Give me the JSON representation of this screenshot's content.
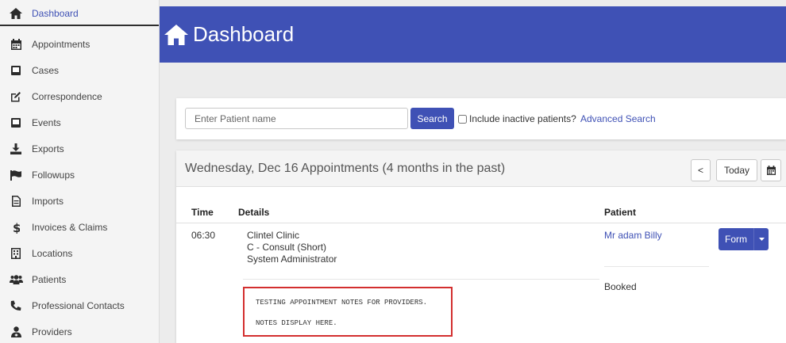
{
  "sidebar": {
    "items": [
      {
        "label": "Dashboard",
        "icon": "home-icon",
        "active": true
      },
      {
        "label": "Appointments",
        "icon": "calendar-icon"
      },
      {
        "label": "Cases",
        "icon": "folder-icon"
      },
      {
        "label": "Correspondence",
        "icon": "edit-icon"
      },
      {
        "label": "Events",
        "icon": "event-icon"
      },
      {
        "label": "Exports",
        "icon": "download-icon"
      },
      {
        "label": "Followups",
        "icon": "flag-icon"
      },
      {
        "label": "Imports",
        "icon": "file-icon"
      },
      {
        "label": "Invoices & Claims",
        "icon": "dollar-icon"
      },
      {
        "label": "Locations",
        "icon": "building-icon"
      },
      {
        "label": "Patients",
        "icon": "users-icon"
      },
      {
        "label": "Professional Contacts",
        "icon": "phone-icon"
      },
      {
        "label": "Providers",
        "icon": "provider-icon"
      }
    ]
  },
  "header": {
    "title": "Dashboard",
    "icon": "home-icon",
    "color": "#3f51b5"
  },
  "search": {
    "placeholder": "Enter Patient name",
    "value": "",
    "button_label": "Search",
    "inactive_label": "Include inactive patients?",
    "inactive_checked": false,
    "advanced_label": "Advanced Search"
  },
  "appointments": {
    "title": "Wednesday, Dec 16 Appointments (4 months in the past)",
    "prev_label": "<",
    "today_label": "Today",
    "columns": {
      "time": "Time",
      "details": "Details",
      "patient": "Patient"
    },
    "rows": [
      {
        "time": "06:30",
        "details": [
          "Clintel Clinic",
          "C - Consult (Short)",
          "System Administrator"
        ],
        "patient": "Mr adam Billy",
        "status": "Booked",
        "form_label": "Form",
        "notes": [
          "TESTING APPOINTMENT NOTES FOR PROVIDERS.",
          "NOTES DISPLAY HERE."
        ]
      }
    ]
  },
  "colors": {
    "accent": "#3f51b5",
    "highlight": "#d32f2f"
  }
}
